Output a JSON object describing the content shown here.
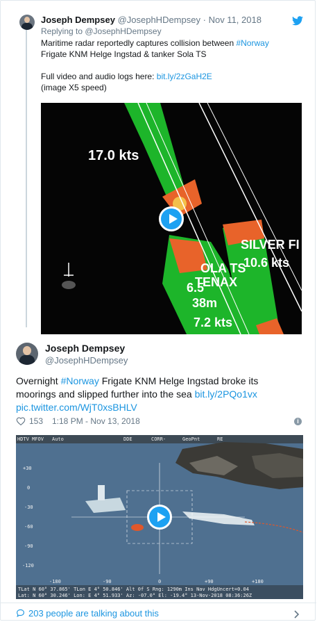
{
  "reply": {
    "name": "Joseph Dempsey",
    "handle": "@JosephHDempsey",
    "separator": "·",
    "date": "Nov 11, 2018",
    "replying_to": "Replying to @JosephHDempsey",
    "line1_a": "Maritime radar reportedly captures collision between ",
    "line1_hashtag": "#Norway",
    "line2": "Frigate KNM Helge Ingstad & tanker Sola TS",
    "line3_a": "Full video and audio logs here: ",
    "line3_link": "bit.ly/2zGaH2E",
    "line4": "(image X5 speed)",
    "radar_labels": {
      "speed_top": "17.0 kts",
      "ship_right": "SILVER FI",
      "speed_right": "10.6 kts",
      "ship_mid": "OLA TS",
      "ship_mid2": "TENAX",
      "speed_mid": "6.5",
      "dist": "38m",
      "speed_bottom": "7.2 kts"
    }
  },
  "main": {
    "name": "Joseph Dempsey",
    "handle": "@JosephHDempsey",
    "text_a": "Overnight ",
    "hashtag": "#Norway",
    "text_b": " Frigate KNM Helge Ingstad broke its",
    "text_c": "moorings and slipped further into the sea ",
    "link1": "bit.ly/2PQo1vx",
    "link2": "pic.twitter.com/WjT0xsBHLV",
    "likes": "153",
    "timestamp": "1:18 PM - Nov 13, 2018",
    "hud": {
      "top": [
        "HDTV MFOV",
        "Auto",
        "DDE",
        "CORR-",
        "GeoPnt",
        "RE"
      ],
      "left_scale": [
        "+30",
        "0",
        "-30",
        "-60",
        "-90",
        "-120"
      ],
      "bottom_scale": [
        "-180",
        "-90",
        "0",
        "+90",
        "+180"
      ],
      "line1": "TLat N  60° 37.865' TLon E   4° 50.846' Alt    0f S Rng: 1290m Ins Nav HdgUncert=0.04",
      "line2": "Lat: N  60° 30.246'   Lon: E   4° 51.933'        Az:   -07.0°    El:  -19.4°   13-Nov-2018 08:36:26Z"
    }
  },
  "footer": {
    "talking": "203 people are talking about this"
  },
  "colors": {
    "link": "#1b95e0",
    "twitter_blue": "#1da1f2",
    "meta_gray": "#657786",
    "radar_green": "#1db52a",
    "radar_orange": "#e8632a"
  },
  "icons": [
    "twitter-bird-icon",
    "play-icon",
    "heart-icon",
    "info-icon",
    "speech-bubble-icon",
    "chevron-right-icon"
  ]
}
